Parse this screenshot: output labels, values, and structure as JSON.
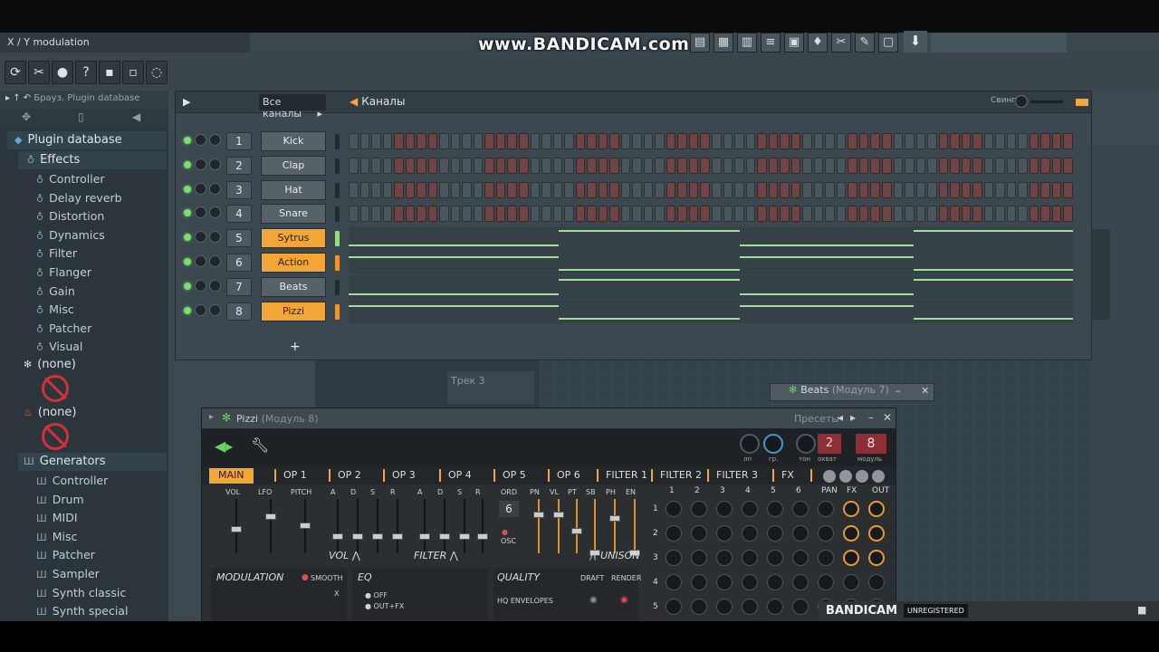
{
  "hint": "X / Y modulation",
  "watermark": "www.BANDICAM.com",
  "browser": {
    "header": "Брауз.  Plugin database",
    "root": "Plugin database",
    "effects_label": "Effects",
    "effects": [
      "Controller",
      "Delay reverb",
      "Distortion",
      "Dynamics",
      "Filter",
      "Flanger",
      "Gain",
      "Misc",
      "Patcher",
      "Visual"
    ],
    "none1": "(none)",
    "none2": "(none)",
    "generators_label": "Generators",
    "generators": [
      "Controller",
      "Drum",
      "MIDI",
      "Misc",
      "Patcher",
      "Sampler",
      "Synth classic",
      "Synth special"
    ]
  },
  "rack": {
    "filter": "Все каналы",
    "title": "Каналы",
    "swing_label": "Свинг",
    "add": "+",
    "channels": [
      {
        "num": "1",
        "name": "Kick",
        "orange": false,
        "type": "steps"
      },
      {
        "num": "2",
        "name": "Clap",
        "orange": false,
        "type": "steps"
      },
      {
        "num": "3",
        "name": "Hat",
        "orange": false,
        "type": "steps"
      },
      {
        "num": "4",
        "name": "Snare",
        "orange": false,
        "type": "steps"
      },
      {
        "num": "5",
        "name": "Sytrus",
        "orange": true,
        "type": "roll"
      },
      {
        "num": "6",
        "name": "Action",
        "orange": true,
        "type": "roll"
      },
      {
        "num": "7",
        "name": "Beats",
        "orange": false,
        "type": "roll"
      },
      {
        "num": "8",
        "name": "Pizzi",
        "orange": true,
        "type": "roll"
      }
    ]
  },
  "playlist": {
    "track3": "Трек 3"
  },
  "beats_window": {
    "title": "Beats",
    "sub": "(Модуль 7)"
  },
  "plugin": {
    "title": "Pizzi",
    "sub": "(Модуль 8)",
    "presets": "Пресеты",
    "knob_labels": [
      "лп",
      "гр.",
      "тон",
      "охват",
      "модуль"
    ],
    "num1": "2",
    "num2": "8",
    "tabs": [
      "MAIN",
      "OP 1",
      "OP 2",
      "OP 3",
      "OP 4",
      "OP 5",
      "OP 6",
      "FILTER 1",
      "FILTER 2",
      "FILTER 3",
      "FX"
    ],
    "labels": {
      "vol": "VOL",
      "lfo": "LFO",
      "pitch": "PITCH",
      "a1": "A",
      "d1": "D",
      "s1": "S",
      "r1": "R",
      "a2": "A",
      "d2": "D",
      "s2": "S",
      "r2": "R",
      "ord": "ORD",
      "pn": "PN",
      "vl": "VL",
      "pt": "PT",
      "sb": "SB",
      "ph": "PH",
      "en": "EN",
      "ord_val": "6",
      "osc": "OSC",
      "vol_big": "VOL",
      "filter_big": "FILTER",
      "unison": "UNISON",
      "modulation": "MODULATION",
      "smooth": "SMOOTH",
      "x": "X",
      "eq": "EQ",
      "off": "OFF",
      "outfx": "OUT+FX",
      "quality": "QUALITY",
      "draft": "DRAFT",
      "render": "RENDER",
      "hq": "HQ ENVELOPES"
    },
    "matrix_cols": [
      "1",
      "2",
      "3",
      "4",
      "5",
      "6",
      "PAN",
      "FX",
      "OUT"
    ],
    "matrix_rows": [
      "1",
      "2",
      "3",
      "4",
      "5"
    ]
  },
  "bandicam": {
    "brand": "BANDICAM",
    "unreg": "UNREGISTERED"
  }
}
